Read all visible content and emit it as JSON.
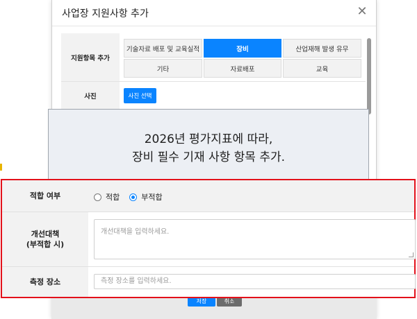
{
  "modal": {
    "title": "사업장 지원사항 추가",
    "close_glyph": "✕"
  },
  "support_items": {
    "label": "지원항목 추가",
    "options": [
      {
        "label": "기술자료 배포 및 교육실적",
        "active": false
      },
      {
        "label": "장비",
        "active": true
      },
      {
        "label": "산업재해 발생 유무",
        "active": false
      },
      {
        "label": "기타",
        "active": false
      },
      {
        "label": "자료배포",
        "active": false
      },
      {
        "label": "교육",
        "active": false
      }
    ]
  },
  "photo": {
    "label": "사진",
    "button": "사진 선택"
  },
  "annotation": {
    "line1": "2026년 평가지표에 따라,",
    "line2": "장비 필수 기재 사항 항목 추가."
  },
  "suitability": {
    "label": "적합 여부",
    "options": [
      {
        "label": "적합",
        "checked": false
      },
      {
        "label": "부적합",
        "checked": true
      }
    ]
  },
  "improvement": {
    "label_line1": "개선대책",
    "label_line2": "(부적합 시)",
    "placeholder": "개선대책을 입력하세요."
  },
  "location": {
    "label": "측정 장소",
    "placeholder": "측정 장소를 입력하세요."
  },
  "footer": {
    "save": "저장",
    "cancel": "취소"
  },
  "colors": {
    "primary": "#0a84ff",
    "highlight_border": "#e3101a",
    "annotation_bg": "#eceff4"
  },
  "icons": [
    "close-icon"
  ]
}
